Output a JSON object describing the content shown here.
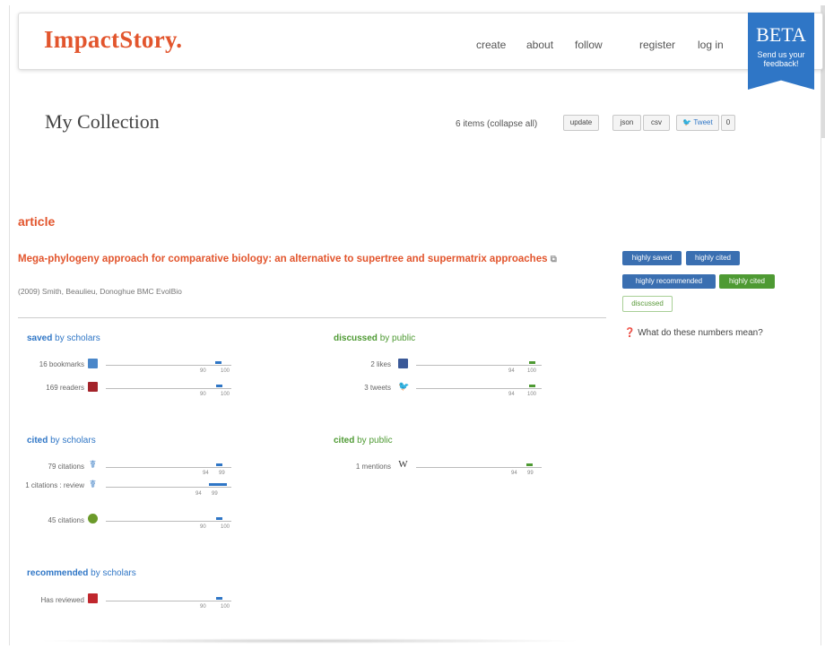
{
  "nav": {
    "logo": "ImpactStory.",
    "links": [
      "create",
      "about",
      "follow",
      "register",
      "log in"
    ],
    "beta": {
      "title": "BETA",
      "subtitle": "Send us your feedback!"
    }
  },
  "collection": {
    "title": "My Collection",
    "item_count": "6 items (collapse all)",
    "update": "update",
    "json": "json",
    "csv": "csv",
    "tweet": "Tweet",
    "tweet_count": "0"
  },
  "section": {
    "heading": "article"
  },
  "article": {
    "title": "Mega-phylogeny approach for comparative biology: an alternative to supertree and supermatrix approaches",
    "citation": "(2009) Smith, Beaulieu, Donoghue BMC EvolBio"
  },
  "badges": [
    {
      "label": "highly saved",
      "color": "blue"
    },
    {
      "label": "highly cited",
      "color": "blue"
    },
    {
      "label": "highly recommended",
      "color": "blue"
    },
    {
      "label": "highly cited",
      "color": "green"
    },
    {
      "label": "discussed",
      "color": "outline"
    }
  ],
  "help_text": "What do these numbers mean?",
  "metrics": {
    "saved": {
      "title_bold": "saved",
      "title_rest": "by scholars",
      "rows": [
        {
          "label": "16 bookmarks",
          "icon": "citeulike-icon",
          "range_lo": "90",
          "range_hi": "100",
          "level": 0.9
        },
        {
          "label": "169 readers",
          "icon": "mendeley-icon",
          "range_lo": "90",
          "range_hi": "100",
          "level": 0.91
        }
      ]
    },
    "discussed": {
      "title_bold": "discussed",
      "title_rest": "by public",
      "rows": [
        {
          "label": "2 likes",
          "icon": "facebook-icon",
          "range_lo": "94",
          "range_hi": "100",
          "level": 0.93
        },
        {
          "label": "3 tweets",
          "icon": "twitter-icon",
          "range_lo": "94",
          "range_hi": "100",
          "level": 0.93
        }
      ]
    },
    "cited_scholars": {
      "title_bold": "cited",
      "title_rest": "by scholars",
      "rows": [
        {
          "label": "79 citations",
          "icon": "scopus-icon",
          "range_lo": "94",
          "range_hi": "99",
          "level": 0.91
        },
        {
          "label": "1 citations : review",
          "icon": "scopus-icon",
          "range_lo": "94",
          "range_hi": "99",
          "level": 0.85
        },
        {
          "label": "45 citations",
          "icon": "pubmed-icon",
          "range_lo": "90",
          "range_hi": "100",
          "level": 0.91
        }
      ]
    },
    "cited_public": {
      "title_bold": "cited",
      "title_rest": "by public",
      "rows": [
        {
          "label": "1 mentions",
          "icon": "wikipedia-icon",
          "range_lo": "94",
          "range_hi": "99",
          "level": 0.91
        }
      ]
    },
    "recommended": {
      "title_bold": "recommended",
      "title_rest": "by scholars",
      "rows": [
        {
          "label": "Has reviewed",
          "icon": "f1000-icon",
          "range_lo": "90",
          "range_hi": "100",
          "level": 0.91
        }
      ]
    }
  },
  "colors": {
    "brand": "#e2552d",
    "scholar_blue": "#2f76c6",
    "public_green": "#4e9a33",
    "beta_blue": "#2f76c6"
  }
}
